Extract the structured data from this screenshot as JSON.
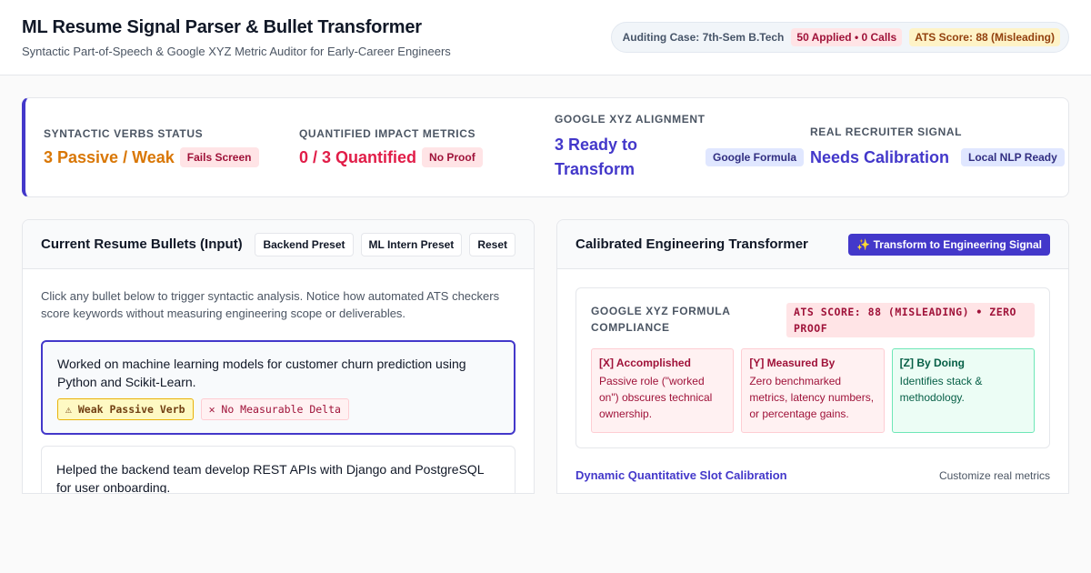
{
  "header": {
    "title": "ML Resume Signal Parser & Bullet Transformer",
    "subtitle": "Syntactic Part-of-Speech & Google XYZ Metric Auditor for Early-Career Engineers",
    "case_label": "Auditing Case: 7th-Sem B.Tech",
    "applied": "50 Applied • 0 Calls",
    "ats": "ATS Score: 88 (Misleading)"
  },
  "metrics": [
    {
      "label": "Syntactic Verbs Status",
      "value": "3 Passive / Weak",
      "tag": "Fails Screen"
    },
    {
      "label": "Quantified Impact Metrics",
      "value": "0 / 3 Quantified",
      "tag": "No Proof"
    },
    {
      "label": "Google XYZ Alignment",
      "value": "3 Ready to Transform",
      "tag": "Google Formula"
    },
    {
      "label": "Real Recruiter Signal",
      "value": "Needs Calibration",
      "tag": "Local NLP Ready"
    }
  ],
  "input_panel": {
    "title": "Current Resume Bullets (Input)",
    "buttons": [
      "Backend Preset",
      "ML Intern Preset",
      "Reset"
    ],
    "hint": "Click any bullet below to trigger syntactic analysis. Notice how automated ATS checkers score keywords without measuring engineering scope or deliverables.",
    "bullets": [
      {
        "text": "Worked on machine learning models for customer churn prediction using Python and Scikit-Learn.",
        "chips": [
          "⚠ Weak Passive Verb",
          "✕ No Measurable Delta"
        ]
      },
      {
        "text": "Helped the backend team develop REST APIs with Django and PostgreSQL for user onboarding."
      }
    ]
  },
  "transform_panel": {
    "title": "Calibrated Engineering Transformer",
    "action": "✨ Transform to Engineering Signal",
    "xyz_title": "Google XYZ Formula Compliance",
    "xyz_score": "ATS SCORE: 88 (MISLEADING) • ZERO PROOF",
    "boxes": [
      {
        "head": "[X] Accomplished",
        "text": "Passive role (\"worked on\") obscures technical ownership."
      },
      {
        "head": "[Y] Measured By",
        "text": "Zero benchmarked metrics, latency numbers, or percentage gains."
      },
      {
        "head": "[Z] By Doing",
        "text": "Identifies stack & methodology."
      }
    ],
    "dynamic_title": "Dynamic Quantitative Slot Calibration",
    "dynamic_link": "Customize real metrics"
  }
}
